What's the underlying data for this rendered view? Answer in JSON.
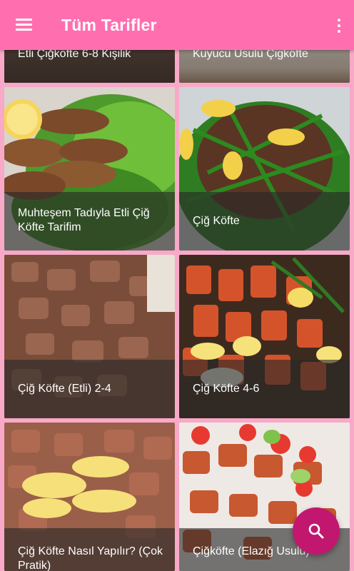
{
  "appbar": {
    "title": "Tüm Tarifler",
    "menu_icon": "hamburger-menu-icon",
    "more_icon": "more-vert-icon"
  },
  "recipes": [
    {
      "title": "Etli Çiğköfte 6-8 Kişilik"
    },
    {
      "title": "Kuyucu Usulü Çigköfte"
    },
    {
      "title": "Muhteşem Tadıyla Etli Çiğ Köfte Tarifim"
    },
    {
      "title": "Çiğ Köfte"
    },
    {
      "title": "Çiğ Köfte (Etli) 2-4"
    },
    {
      "title": "Çiğ Köfte 4-6"
    },
    {
      "title": "Çiğ Köfte Nasıl Yapılır? (Çok Pratik)"
    },
    {
      "title": "Çiğköfte (Elazığ Usulü)"
    }
  ],
  "fab": {
    "icon": "search-icon"
  },
  "colors": {
    "appbar": "#ff6fb0",
    "background": "#f8a9c8",
    "fab": "#c2176f"
  }
}
